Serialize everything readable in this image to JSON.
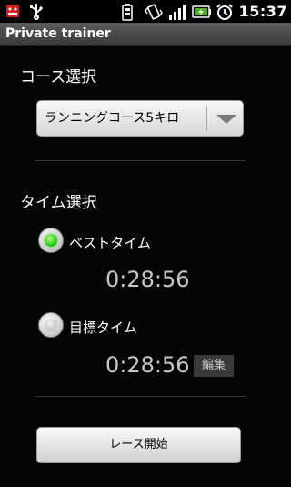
{
  "status_bar": {
    "time": "15:37",
    "icons": [
      "android-debug-icon",
      "usb-icon",
      "battery-small-icon",
      "vibrate-icon",
      "signal-icon",
      "battery-charging-icon",
      "alarm-icon"
    ]
  },
  "title_bar": {
    "title": "Private trainer"
  },
  "course": {
    "label": "コース選択",
    "selected": "ランニングコース5キロ"
  },
  "time_section": {
    "label": "タイム選択",
    "best": {
      "label": "ベストタイム",
      "value": "0:28:56",
      "checked": true
    },
    "target": {
      "label": "目標タイム",
      "value": "0:28:56",
      "checked": false,
      "edit_label": "編集"
    }
  },
  "start_button": {
    "label": "レース開始"
  },
  "colors": {
    "radio_checked": "#2bcc15",
    "background": "#000000",
    "title_bar": "#4a4a4a"
  }
}
